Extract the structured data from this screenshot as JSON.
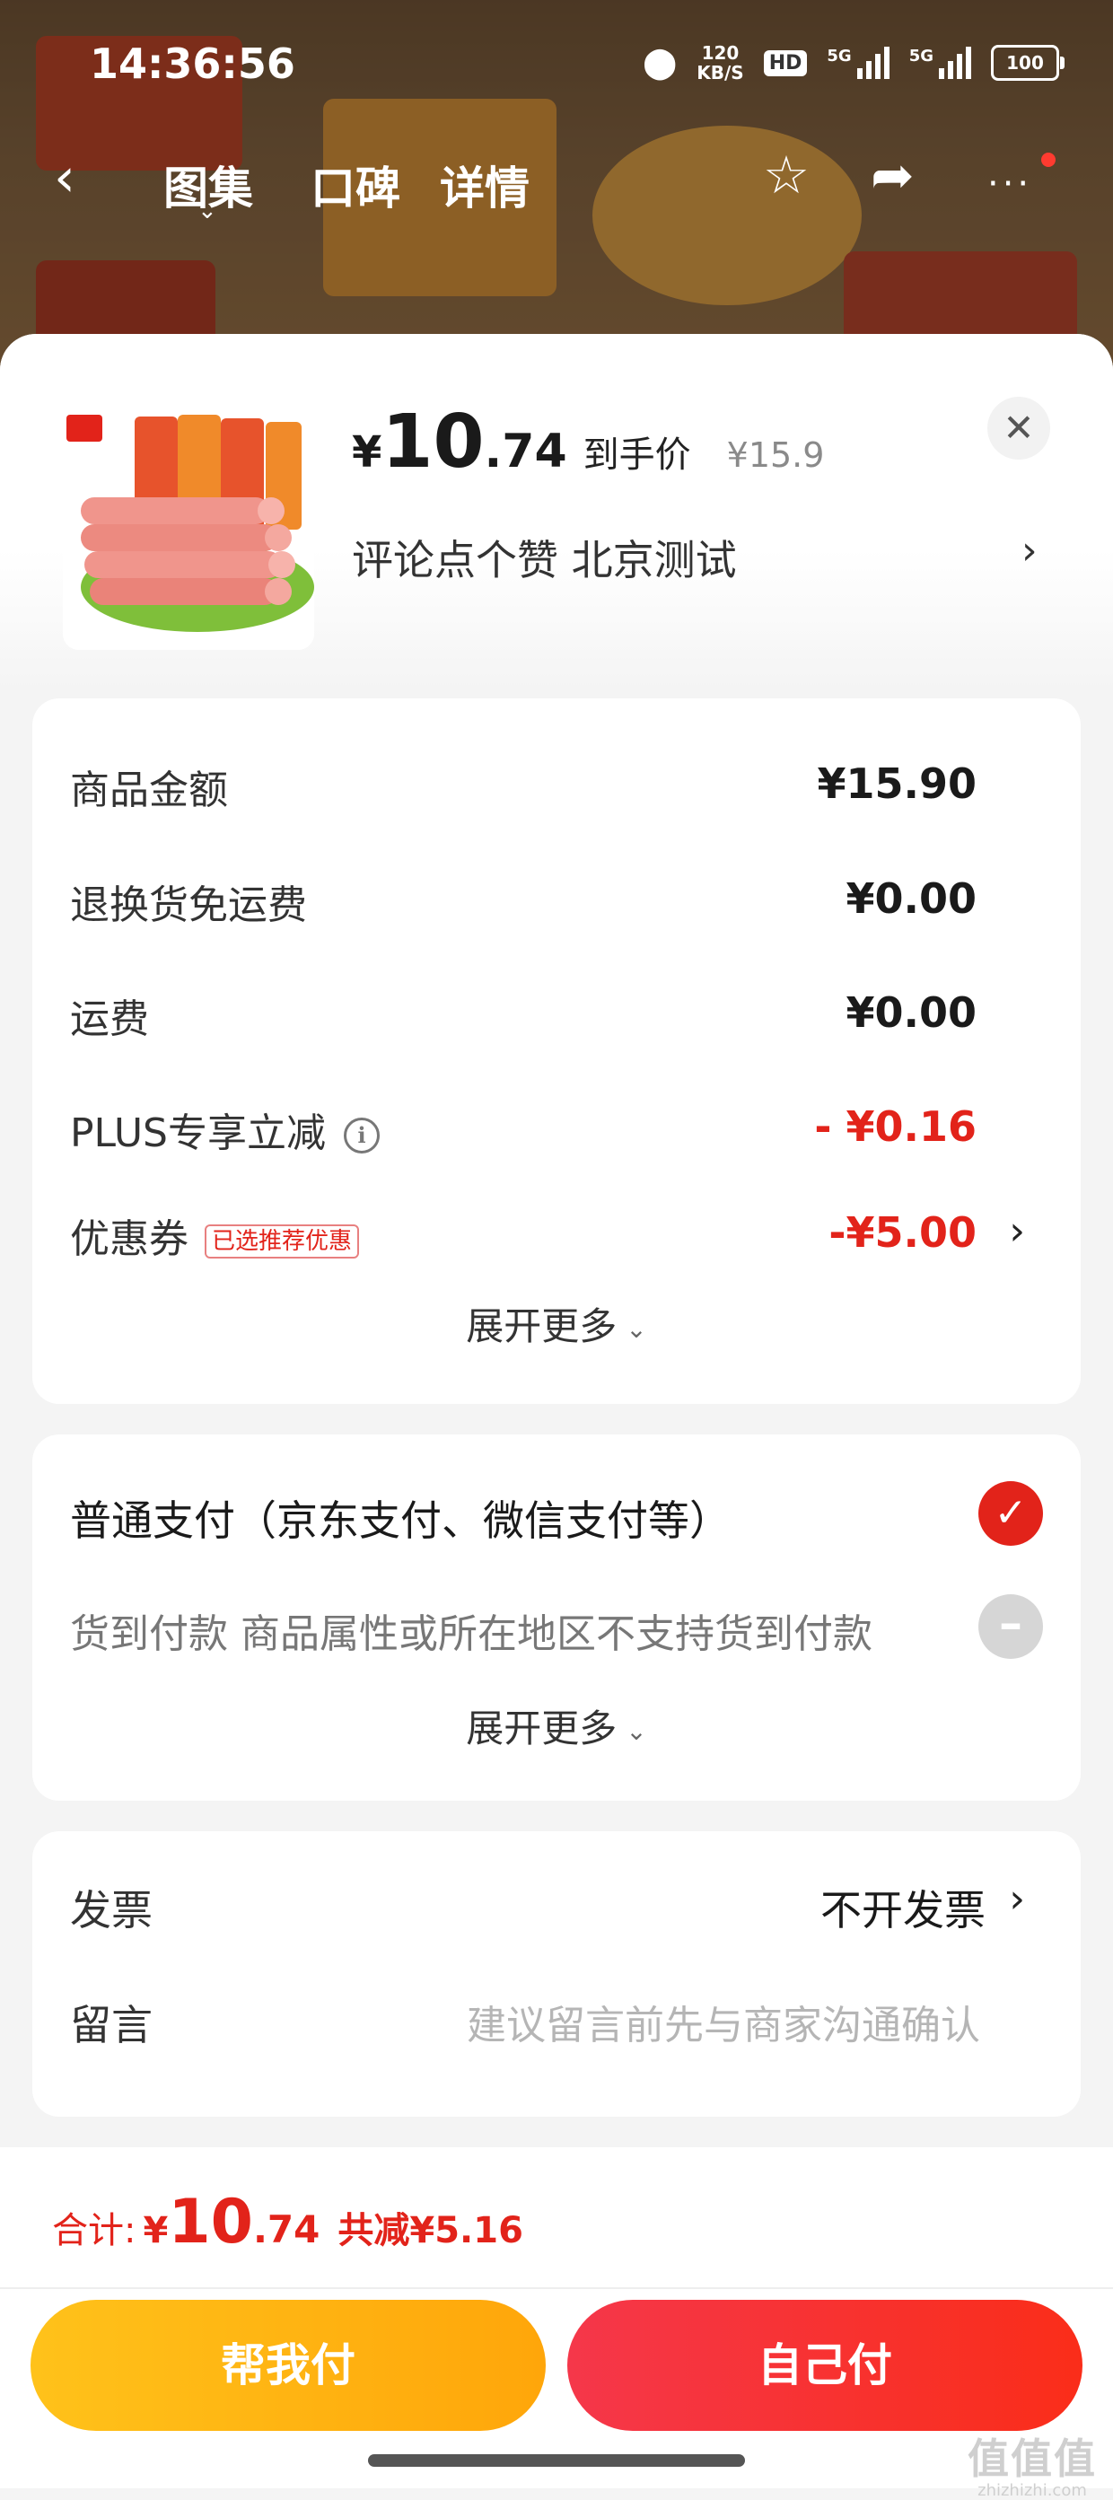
{
  "status_bar": {
    "time": "14:36:56",
    "net_speed_value": "120",
    "net_speed_unit": "KB/S",
    "hd_label": "HD",
    "signal1_label": "5G",
    "signal2_label": "5G",
    "battery": "100"
  },
  "nav": {
    "tabs": [
      "图集",
      "口碑",
      "详情"
    ],
    "icons": [
      "back-icon",
      "star-icon",
      "share-icon",
      "more-icon"
    ]
  },
  "product": {
    "price_symbol": "¥",
    "price_integer": "10",
    "price_decimal": ".74",
    "price_tag": "到手价",
    "original_price": "¥15.9",
    "spec": "评论点个赞  北京测试",
    "close_icon": "close-icon"
  },
  "fees": {
    "goods_amount_label": "商品金额",
    "goods_amount_value": "¥15.90",
    "return_shipping_label": "退换货免运费",
    "return_shipping_value": "¥0.00",
    "shipping_label": "运费",
    "shipping_value": "¥0.00",
    "plus_label": "PLUS专享立减",
    "plus_value": "- ¥0.16",
    "coupon_label": "优惠券",
    "coupon_badge": "已选推荐优惠",
    "coupon_value": "-¥5.00",
    "expand_label": "展开更多"
  },
  "payment": {
    "normal_label": "普通支付（京东支付、微信支付等）",
    "cod_label": "货到付款 商品属性或所在地区不支持货到付款",
    "expand_label": "展开更多"
  },
  "invoice": {
    "invoice_label": "发票",
    "invoice_value": "不开发票",
    "message_label": "留言",
    "message_placeholder": "建议留言前先与商家沟通确认"
  },
  "footer": {
    "total_label": "合计:",
    "total_symbol": "¥",
    "total_integer": "10",
    "total_decimal": ".74",
    "saved_label": "共减¥5.16",
    "help_pay_button": "帮我付",
    "self_pay_button": "自己付"
  },
  "watermark": {
    "main": "值值值",
    "sub": "zhizhizhi.com"
  },
  "colors": {
    "accent_red": "#e2231a",
    "help_button": "#ffb414",
    "self_button": "#f5374a"
  }
}
